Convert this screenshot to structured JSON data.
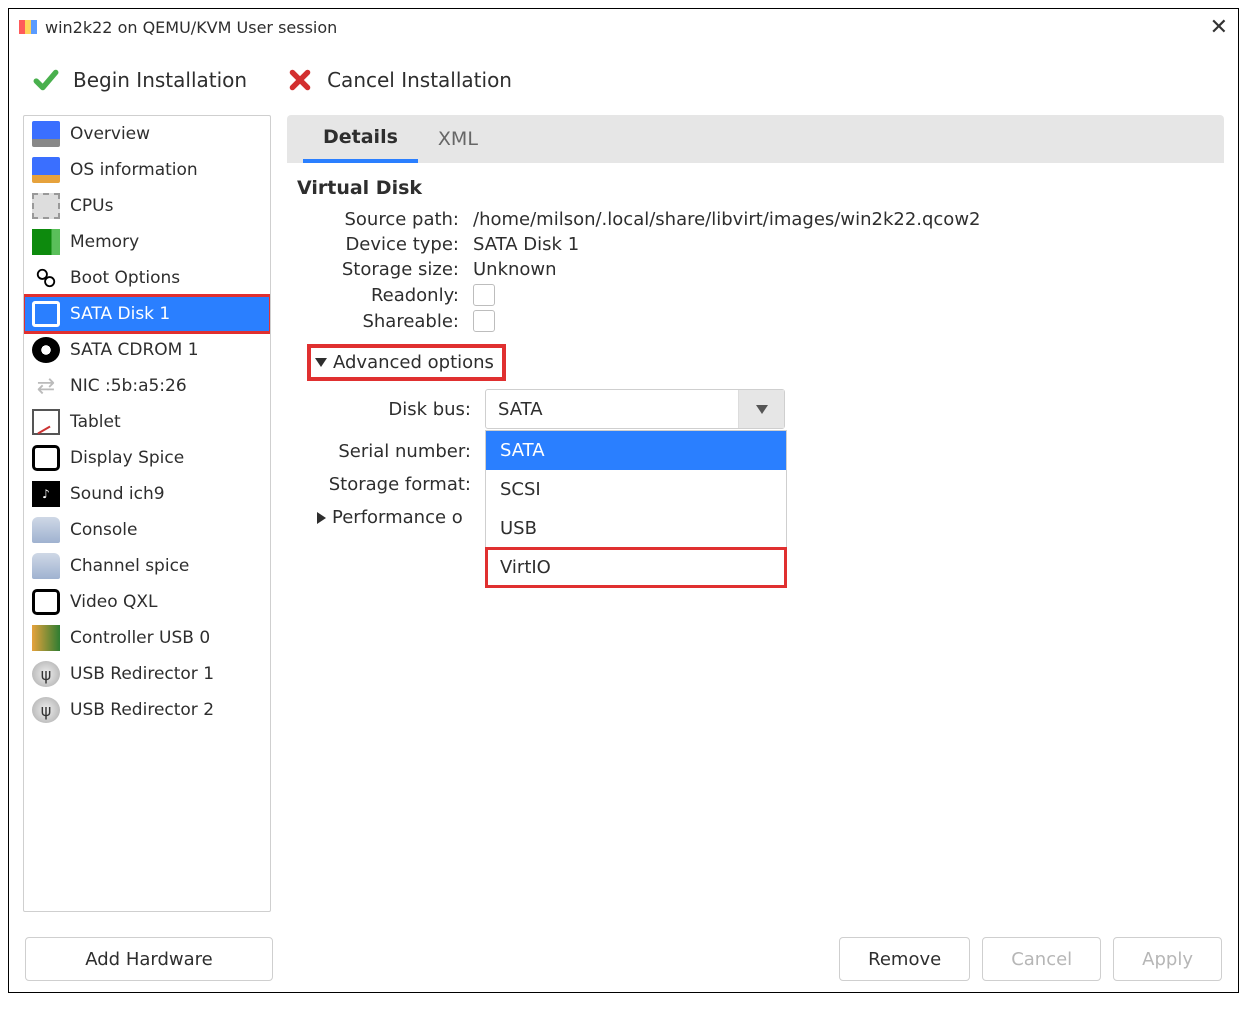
{
  "window": {
    "title": "win2k22 on QEMU/KVM User session"
  },
  "toolbar": {
    "begin_label": "Begin Installation",
    "cancel_label": "Cancel Installation"
  },
  "sidebar": {
    "items": [
      {
        "label": "Overview"
      },
      {
        "label": "OS information"
      },
      {
        "label": "CPUs"
      },
      {
        "label": "Memory"
      },
      {
        "label": "Boot Options"
      },
      {
        "label": "SATA Disk 1"
      },
      {
        "label": "SATA CDROM 1"
      },
      {
        "label": "NIC :5b:a5:26"
      },
      {
        "label": "Tablet"
      },
      {
        "label": "Display Spice"
      },
      {
        "label": "Sound ich9"
      },
      {
        "label": "Console"
      },
      {
        "label": "Channel spice"
      },
      {
        "label": "Video QXL"
      },
      {
        "label": "Controller USB 0"
      },
      {
        "label": "USB Redirector 1"
      },
      {
        "label": "USB Redirector 2"
      }
    ],
    "selected_index": 5
  },
  "tabs": {
    "details": "Details",
    "xml": "XML",
    "active": "details"
  },
  "disk": {
    "title": "Virtual Disk",
    "labels": {
      "source_path": "Source path:",
      "device_type": "Device type:",
      "storage_size": "Storage size:",
      "readonly": "Readonly:",
      "shareable": "Shareable:"
    },
    "source_path": "/home/milson/.local/share/libvirt/images/win2k22.qcow2",
    "device_type": "SATA Disk 1",
    "storage_size": "Unknown",
    "readonly": false,
    "shareable": false
  },
  "advanced": {
    "header": "Advanced options",
    "expanded": true,
    "labels": {
      "disk_bus": "Disk bus:",
      "serial_number": "Serial number:",
      "storage_format": "Storage format:"
    },
    "disk_bus_value": "SATA",
    "disk_bus_options": [
      "SATA",
      "SCSI",
      "USB",
      "VirtIO"
    ],
    "dropdown_open": true,
    "dropdown_highlight_index": 0,
    "dropdown_redbox_index": 3
  },
  "performance": {
    "header": "Performance options",
    "header_visible": "Performance o"
  },
  "buttons": {
    "add_hardware": "Add Hardware",
    "remove": "Remove",
    "cancel": "Cancel",
    "apply": "Apply"
  },
  "highlights": {
    "sidebar_selected_redbox": true,
    "advanced_header_redbox": true
  }
}
